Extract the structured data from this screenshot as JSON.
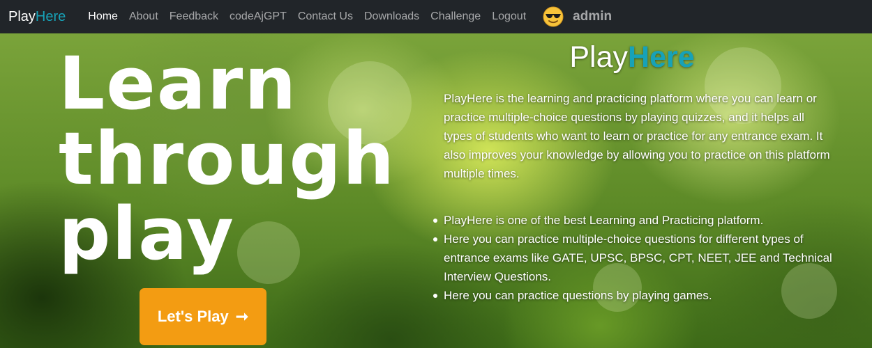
{
  "navbar": {
    "brand": {
      "part1": "Play",
      "part2": "Here",
      "accent_color": "#17a2b8"
    },
    "links": [
      "Home",
      "About",
      "Feedback",
      "codeAjGPT",
      "Contact Us",
      "Downloads",
      "Challenge",
      "Logout"
    ],
    "active_link": "Home",
    "user": {
      "avatar_icon": "sunglasses-emoji-icon",
      "name": "admin"
    }
  },
  "hero": {
    "title_lines": [
      "Learn",
      "through",
      "play"
    ],
    "cta": {
      "label": "Let's Play",
      "arrow": "➞",
      "color": "#f39c12"
    }
  },
  "about": {
    "title": {
      "part1": "Play",
      "part2": "Here"
    },
    "description": "PlayHere is the learning and practicing platform where you can learn or practice multiple-choice questions by playing quizzes, and it helps all types of students who want to learn or practice for any entrance exam. It also improves your knowledge by allowing you to practice on this platform multiple times.",
    "features": [
      "PlayHere is one of the best Learning and Practicing platform.",
      "Here you can practice multiple-choice questions for different types of entrance exams like GATE, UPSC, BPSC, CPT, NEET, JEE and Technical Interview Questions.",
      "Here you can practice questions by playing games."
    ]
  }
}
